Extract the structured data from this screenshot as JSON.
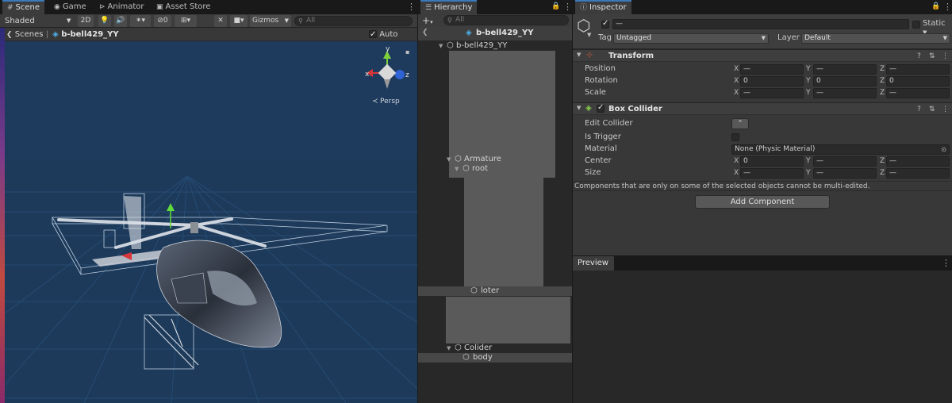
{
  "scene": {
    "tabs": [
      {
        "label": "Scene",
        "icon": "grid-icon"
      },
      {
        "label": "Game",
        "icon": "gamepad-icon"
      },
      {
        "label": "Animator",
        "icon": "animator-icon"
      },
      {
        "label": "Asset Store",
        "icon": "store-icon"
      }
    ],
    "toolbar": {
      "shading_mode": "Shaded",
      "mode_2d": "2D",
      "hidden_count": "0",
      "gizmos_label": "Gizmos",
      "search_placeholder": "All"
    },
    "breadcrumb": {
      "root": "Scenes",
      "object": "b-bell429_YY",
      "auto_save_label": "Auto Save",
      "auto_save_checked": true
    },
    "gizmo": {
      "axis_y": "y",
      "axis_x": "x",
      "axis_z": "z",
      "projection": "Persp"
    }
  },
  "hierarchy": {
    "tab_label": "Hierarchy",
    "search_placeholder": "All",
    "scene_root": "b-bell429_YY",
    "items": [
      {
        "label": "b-bell429_YY"
      },
      {
        "label": "Armature"
      },
      {
        "label": "root"
      },
      {
        "label": "loter"
      },
      {
        "label": "Colider"
      },
      {
        "label": "body"
      }
    ]
  },
  "inspector": {
    "tab_label": "Inspector",
    "name_value": "—",
    "static_label": "Static",
    "tag_label": "Tag",
    "tag_value": "Untagged",
    "layer_label": "Layer",
    "layer_value": "Default",
    "transform": {
      "title": "Transform",
      "rows": [
        {
          "label": "Position",
          "x": "—",
          "y": "—",
          "z": "—"
        },
        {
          "label": "Rotation",
          "x": "0",
          "y": "0",
          "z": "0"
        },
        {
          "label": "Scale",
          "x": "—",
          "y": "—",
          "z": "—"
        }
      ]
    },
    "box_collider": {
      "title": "Box Collider",
      "edit_collider_label": "Edit Collider",
      "is_trigger_label": "Is Trigger",
      "material_label": "Material",
      "material_value": "None (Physic Material)",
      "center": {
        "label": "Center",
        "x": "0",
        "y": "—",
        "z": "—"
      },
      "size": {
        "label": "Size",
        "x": "—",
        "y": "—",
        "z": "—"
      }
    },
    "multi_edit_note": "Components that are only on some of the selected objects cannot be multi-edited.",
    "add_component_label": "Add Component"
  },
  "preview": {
    "label": "Preview"
  },
  "axis_letters": {
    "x": "X",
    "y": "Y",
    "z": "Z"
  },
  "colors": {
    "scene_bg": "#1a3554",
    "accent_blue": "#3a79bb",
    "gizmo_x": "#d6363a",
    "gizmo_y": "#7fd33a",
    "gizmo_z": "#3a6bd6"
  }
}
